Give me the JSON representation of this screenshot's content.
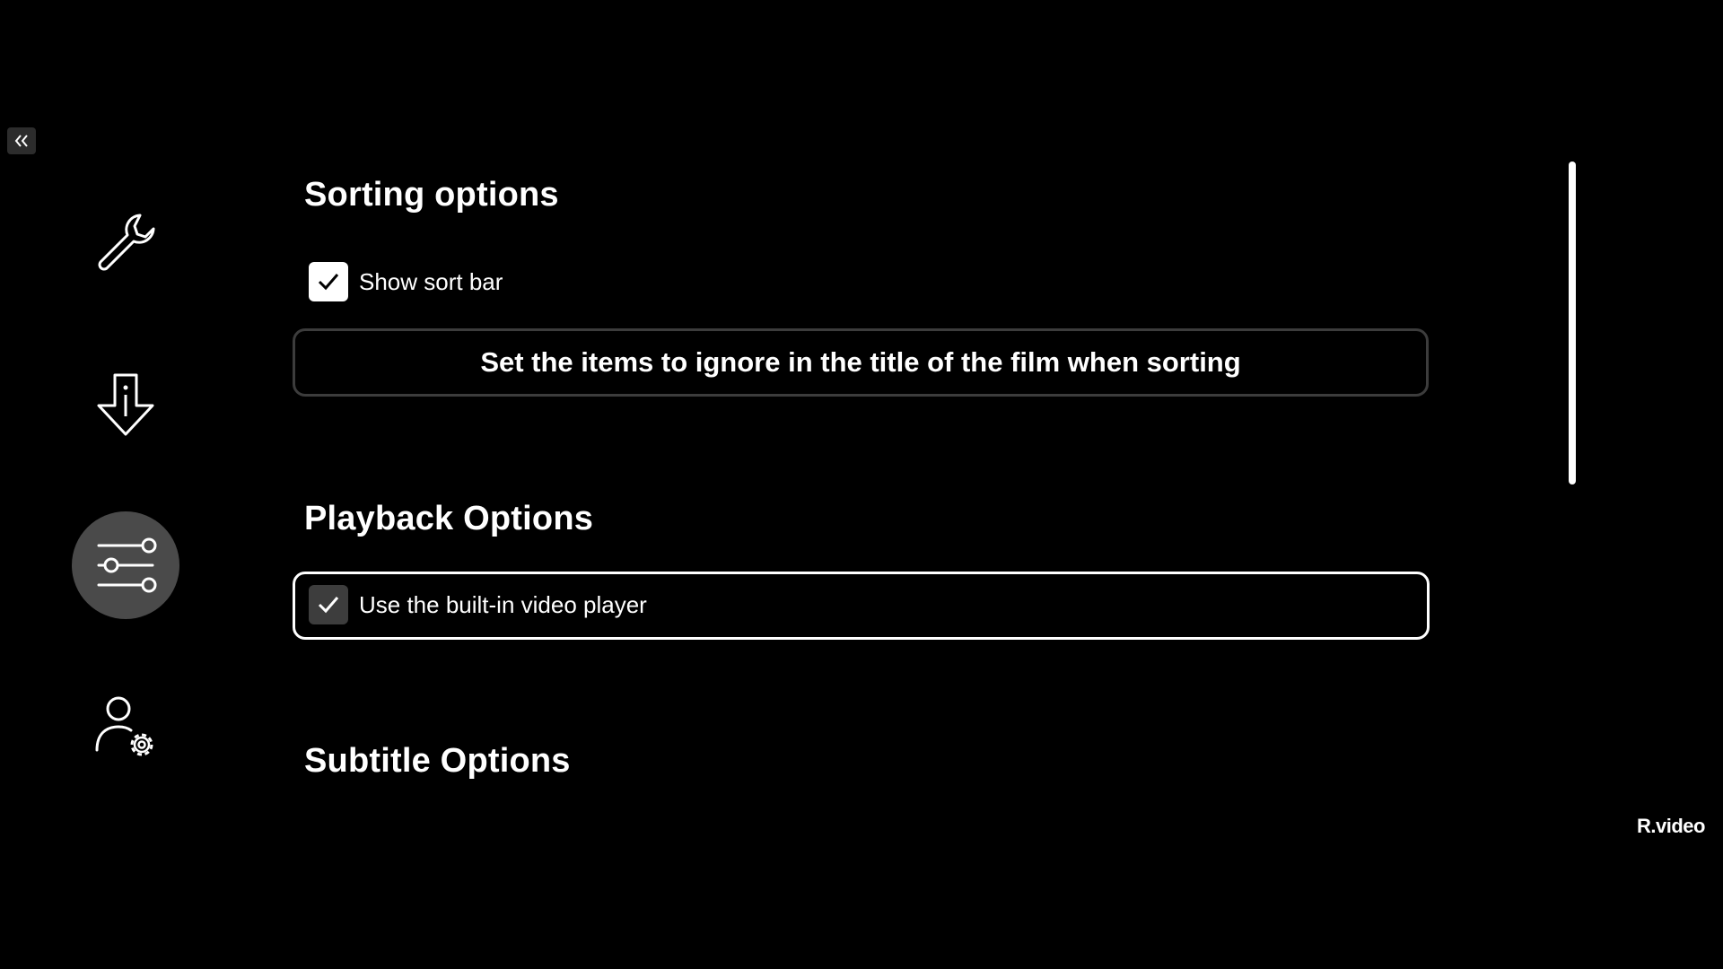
{
  "sidebar": {
    "collapse_icon": "double-chevron-left-icon",
    "items": [
      {
        "icon": "wrench-icon",
        "active": false
      },
      {
        "icon": "download-arrow-icon",
        "active": false
      },
      {
        "icon": "sliders-icon",
        "active": true
      },
      {
        "icon": "user-settings-icon",
        "active": false
      }
    ]
  },
  "sections": {
    "sorting": {
      "title": "Sorting options",
      "show_sort_bar": {
        "label": "Show sort bar",
        "checked": true
      },
      "ignore_button_label": "Set the items to ignore in the title of the film when sorting"
    },
    "playback": {
      "title": "Playback Options",
      "builtin_player": {
        "label": "Use the built-in video player",
        "checked": true
      }
    },
    "subtitle": {
      "title": "Subtitle Options"
    }
  },
  "brand": {
    "logo_text": "R.video"
  },
  "colors": {
    "background": "#000000",
    "text": "#ffffff",
    "active_nav": "#4a4a4a",
    "button_border": "#3c3c3c",
    "focus_border": "#ffffff"
  }
}
